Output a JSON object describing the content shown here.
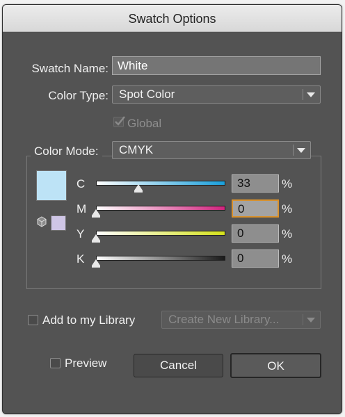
{
  "dialog": {
    "title": "Swatch Options"
  },
  "swatch_name": {
    "label": "Swatch Name:",
    "value": "White"
  },
  "color_type": {
    "label": "Color Type:",
    "value": "Spot Color"
  },
  "global": {
    "label": "Global",
    "checked": true,
    "enabled": false
  },
  "color_mode": {
    "label": "Color Mode:",
    "value": "CMYK"
  },
  "swatch_preview": {
    "current_color": "#bde3f6",
    "previous_color": "#cfc6e6"
  },
  "channels": [
    {
      "label": "C",
      "value": "33",
      "percent": 33,
      "unit": "%",
      "gradient_end": "#1a9fdb"
    },
    {
      "label": "M",
      "value": "0",
      "percent": 0,
      "unit": "%",
      "gradient_end": "#d1237e"
    },
    {
      "label": "Y",
      "value": "0",
      "percent": 0,
      "unit": "%",
      "gradient_end": "#d5e21b"
    },
    {
      "label": "K",
      "value": "0",
      "percent": 0,
      "unit": "%",
      "gradient_end": "#1a1a1a"
    }
  ],
  "library": {
    "label": "Add to my Library",
    "dropdown_value": "Create New Library..."
  },
  "preview": {
    "label": "Preview"
  },
  "buttons": {
    "cancel": "Cancel",
    "ok": "OK"
  }
}
